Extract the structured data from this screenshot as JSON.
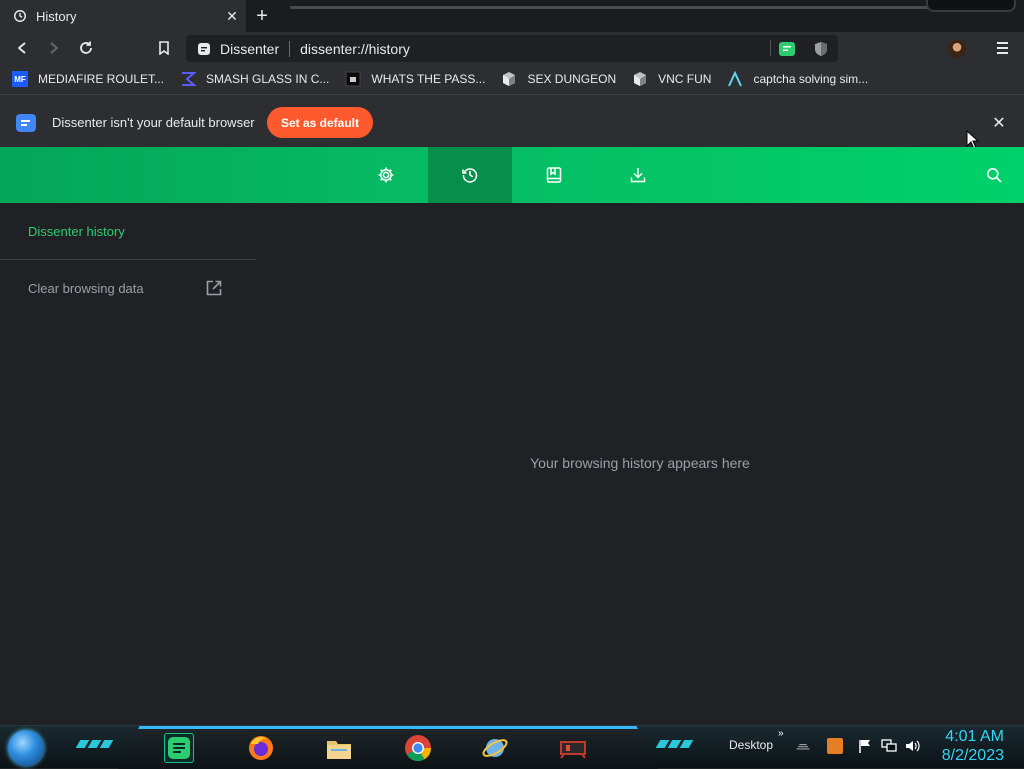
{
  "tab": {
    "title": "History",
    "close_glyph": "✕",
    "icon": "history-icon"
  },
  "newtab": {
    "glyph": "+"
  },
  "toolbar": {
    "site_name": "Dissenter",
    "url": "dissenter://history"
  },
  "bookmarks": [
    {
      "label": "MEDIAFIRE ROULET...",
      "icon": "mediafire-icon",
      "icon_text": "MF"
    },
    {
      "label": "SMASH GLASS IN C...",
      "icon": "sigma-icon"
    },
    {
      "label": "WHATS THE PASS...",
      "icon": "square-icon"
    },
    {
      "label": "SEX DUNGEON",
      "icon": "cube-icon"
    },
    {
      "label": "VNC FUN",
      "icon": "cube-icon"
    },
    {
      "label": "captcha solving sim...",
      "icon": "lambda-icon"
    }
  ],
  "infobar": {
    "message": "Dissenter isn't your default browser",
    "button_label": "Set as default",
    "close_glyph": "✕"
  },
  "nav": {
    "items": [
      "settings-icon",
      "history-icon",
      "bookmarks-icon",
      "downloads-icon"
    ],
    "active": "history-icon"
  },
  "sidebar": {
    "title": "Dissenter history",
    "clear_label": "Clear browsing data"
  },
  "main": {
    "empty_message": "Your browsing history appears here"
  },
  "taskbar": {
    "desktop_label": "Desktop",
    "overflow_glyph": "»",
    "time": "4:01 AM",
    "date": "8/2/2023",
    "accent_color": "#35d3f5"
  },
  "colors": {
    "brand_green": "#07b862",
    "button_orange": "#ff5a2e",
    "sidebar_title": "#2ecc71"
  }
}
